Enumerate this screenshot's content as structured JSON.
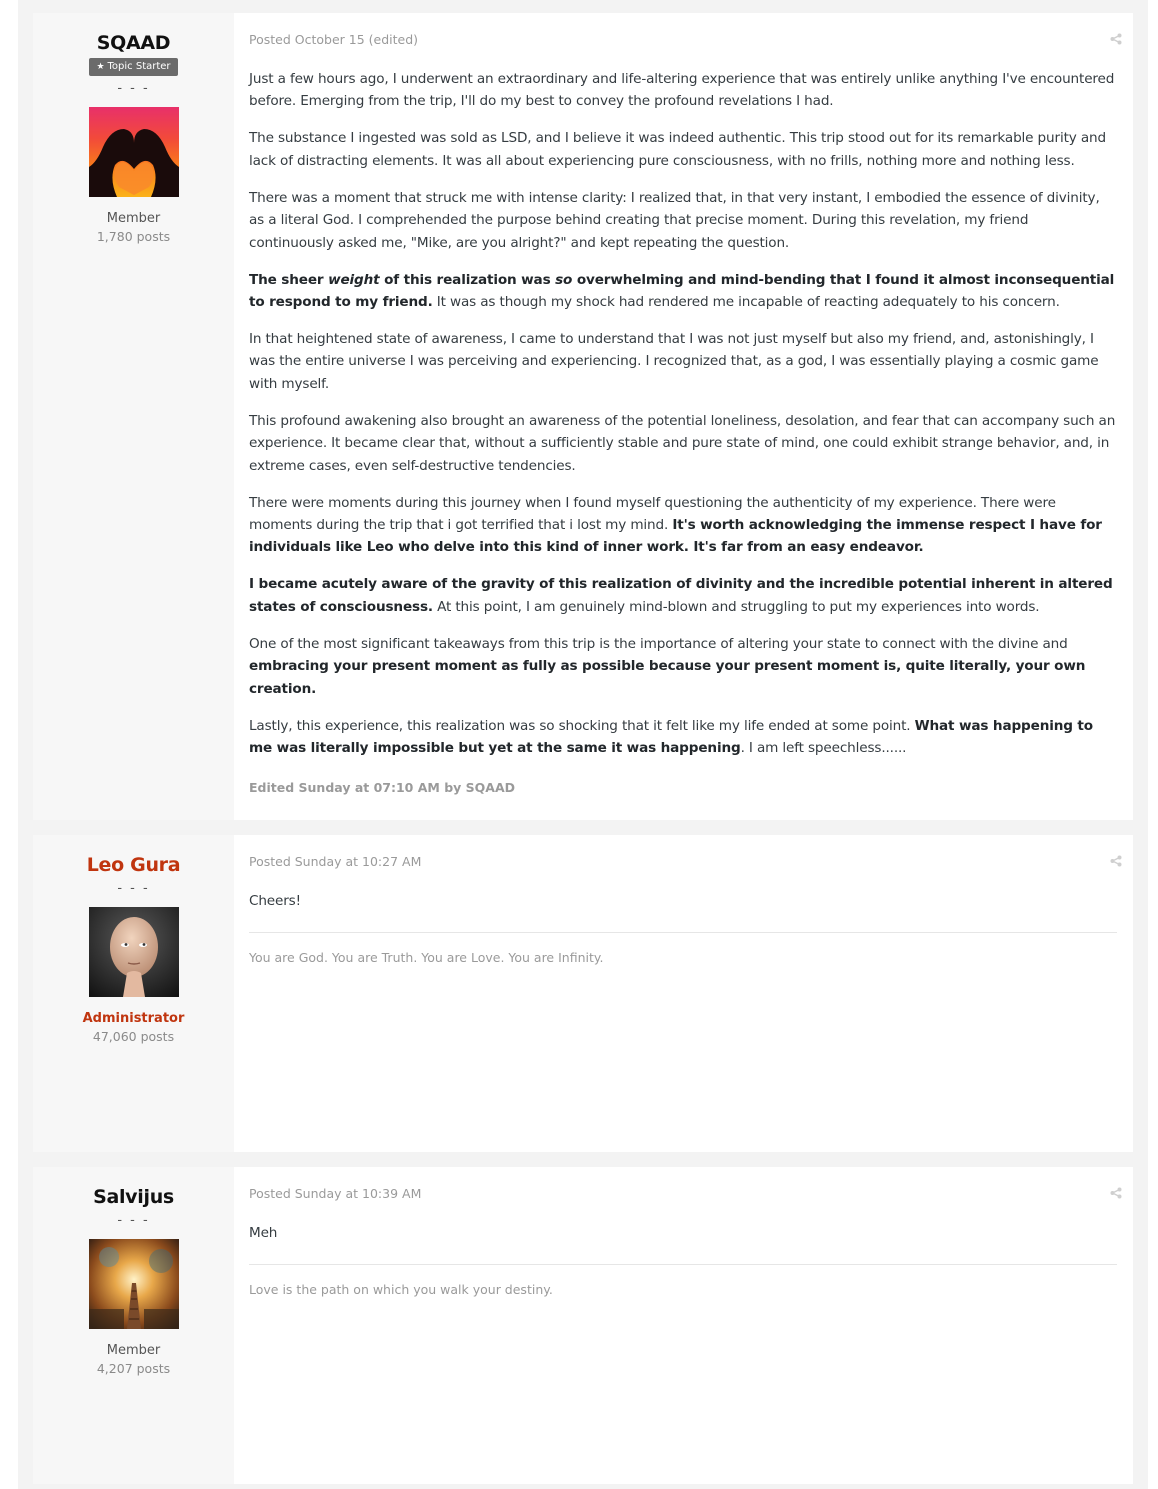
{
  "posts": [
    {
      "author": "SQAAD",
      "badge": "Topic Starter",
      "dots": "- - -",
      "role": "Member",
      "post_count": "1,780 posts",
      "posted_label": "Posted October 15 (edited)",
      "paragraphs": [
        [
          {
            "t": "Just a few hours ago, I underwent an extraordinary and life-altering experience that was entirely unlike anything I've encountered before. Emerging from the trip, I'll do my best to convey the profound revelations I had."
          }
        ],
        [
          {
            "t": "The substance I ingested was sold as LSD, and I believe it was indeed authentic. This trip stood out for its remarkable purity and lack of distracting elements. It was all about experiencing pure consciousness, with no frills, nothing more and nothing less."
          }
        ],
        [
          {
            "t": "There was a moment that struck me with intense clarity: I realized that, in that very instant, I embodied the essence of divinity, as a literal God. I comprehended the purpose behind creating that precise moment. During this revelation, my friend continuously asked me, \"Mike, are you alright?\" and kept repeating the question."
          }
        ],
        [
          {
            "t": "The sheer ",
            "b": true
          },
          {
            "t": "weight",
            "b": true,
            "i": true
          },
          {
            "t": " of this realization was ",
            "b": true
          },
          {
            "t": "so",
            "b": true,
            "i": true
          },
          {
            "t": " overwhelming and mind-bending that I found it almost inconsequential to respond to my friend.",
            "b": true
          },
          {
            "t": " It was as though my shock had rendered me incapable of reacting adequately to his concern."
          }
        ],
        [
          {
            "t": "In that heightened state of awareness, I came to understand that I was not just myself but also my friend, and, astonishingly, I was the entire universe I was perceiving and experiencing. I recognized that, as a god, I was essentially playing a cosmic game with myself."
          }
        ],
        [
          {
            "t": "This profound awakening also brought an awareness of the potential loneliness, desolation, and fear that can accompany such an experience. It became clear that, without a sufficiently stable and pure state of mind, one could exhibit strange behavior, and, in extreme cases, even self-destructive tendencies."
          }
        ],
        [
          {
            "t": "There were moments during this journey when I found myself questioning the authenticity of my experience. There were moments during the trip that i got terrified that i lost my mind. "
          },
          {
            "t": "It's worth acknowledging the immense respect I have for individuals like Leo who delve into this kind of inner work. It's far from an easy endeavor.",
            "b": true
          }
        ],
        [
          {
            "t": "I became acutely aware of the gravity of this realization of divinity and the incredible potential inherent in altered states of consciousness.",
            "b": true
          },
          {
            "t": " At this point, I am genuinely mind-blown and struggling to put my experiences into words."
          }
        ],
        [
          {
            "t": "One of the most significant takeaways from this trip is the importance of altering your state to connect with the divine and "
          },
          {
            "t": "embracing your present moment as fully as possible because your present moment is, quite literally, your own creation.",
            "b": true
          }
        ],
        [
          {
            "t": "Lastly, this experience, this realization was so shocking that it felt like my life ended at some point. "
          },
          {
            "t": "What was happening to me was literally impossible but yet at the same it was happening",
            "b": true
          },
          {
            "t": ". I am left speechless......"
          }
        ]
      ],
      "edited_label": "Edited Sunday at 07:10 AM by SQAAD"
    },
    {
      "author": "Leo Gura",
      "dots": "- - -",
      "role": "Administrator",
      "post_count": "47,060 posts",
      "posted_label": "Posted Sunday at 10:27 AM",
      "paragraphs": [
        [
          {
            "t": "Cheers!"
          }
        ]
      ],
      "signature": "You are God. You are Truth. You are Love. You are Infinity."
    },
    {
      "author": "Salvijus",
      "dots": "- - -",
      "role": "Member",
      "post_count": "4,207 posts",
      "posted_label": "Posted Sunday at 10:39 AM",
      "paragraphs": [
        [
          {
            "t": "Meh"
          }
        ]
      ],
      "signature": "Love is the path on which you walk your destiny."
    }
  ],
  "icons": {
    "share": "share-icon",
    "star": "star-icon"
  },
  "colors": {
    "admin": "#c0350f",
    "badge": "#6b6b6b",
    "author_panel": "#f7f7f7",
    "page": "#f3f3f3"
  }
}
